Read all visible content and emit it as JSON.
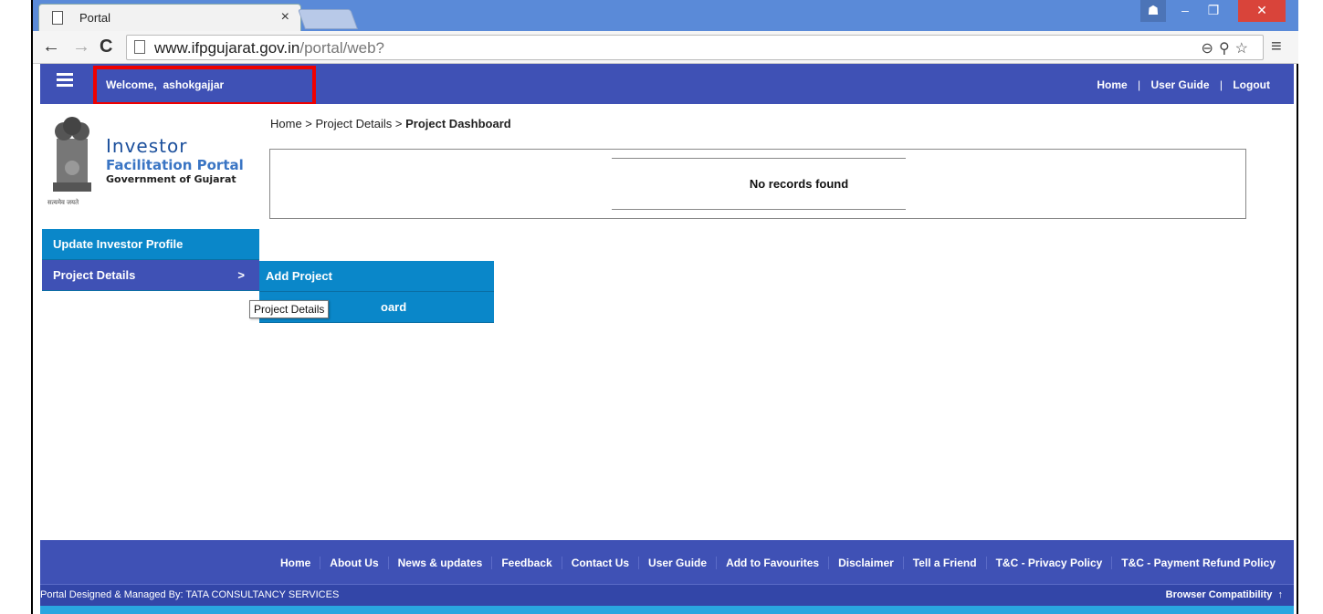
{
  "browser": {
    "tab_title": "Portal",
    "url_host": "www.ifpgujarat.gov.in",
    "url_path": "/portal/web?"
  },
  "header": {
    "welcome_label": "Welcome,",
    "username": "ashokgajjar",
    "links": [
      "Home",
      "User Guide",
      "Logout"
    ],
    "separator": "|"
  },
  "logo": {
    "line1": "Investor",
    "line2": "Facilitation Portal",
    "line3": "Government of Gujarat",
    "motto": "सत्यमेव जयते"
  },
  "breadcrumb": {
    "items": [
      "Home > Project Details > "
    ],
    "current": "Project Dashboard"
  },
  "records": {
    "message": "No records found"
  },
  "side_menu": {
    "items": [
      "Update Investor Profile",
      "Project Details"
    ],
    "arrow": ">"
  },
  "sub_menu": {
    "items": [
      "Add Project",
      "oard"
    ]
  },
  "tooltip": "Project Details",
  "footer": {
    "links": [
      "Home",
      "About Us",
      "News & updates",
      "Feedback",
      "Contact Us",
      "User Guide",
      "Add to Favourites",
      "Disclaimer",
      "Tell a Friend",
      "T&C - Privacy Policy",
      "T&C - Payment Refund Policy"
    ],
    "credit": "Portal Designed & Managed By: TATA CONSULTANCY SERVICES",
    "compat": "Browser Compatibility",
    "up_arrow": "↑"
  },
  "colors": {
    "header_bg": "#3f51b5",
    "page_border": "#2aa6e0",
    "menu_blue": "#0a87c9",
    "highlight": "#e00000"
  }
}
